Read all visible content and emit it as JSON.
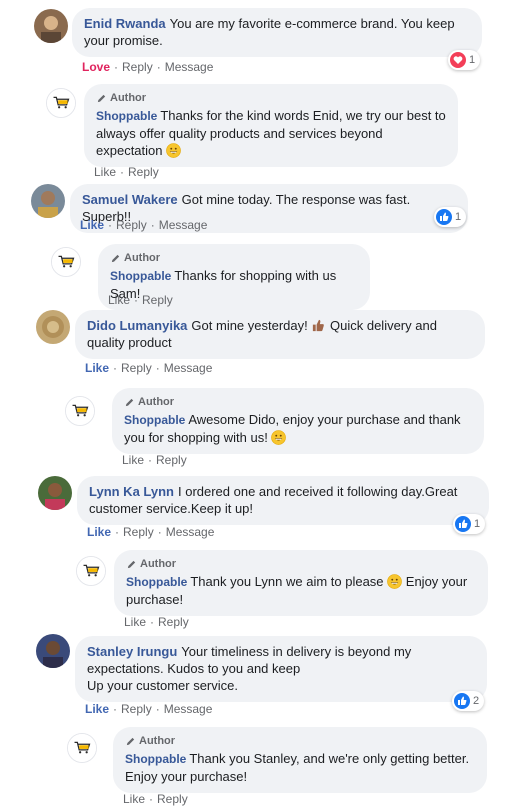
{
  "author_badge": "Author",
  "page_name": "Shoppable",
  "logo_text": "Shoppable",
  "actions": {
    "love": "Love",
    "like": "Like",
    "reply": "Reply",
    "message": "Message"
  },
  "comments": [
    {
      "name": "Enid Rwanda",
      "text": "You are my favorite e-commerce brand. You keep your promise.",
      "reaction_count": "1",
      "reaction_type": "love",
      "reply": "Thanks for the kind words Enid, we try our best to always offer quality products and services beyond expectation"
    },
    {
      "name": "Samuel Wakere",
      "text": "Got mine today. The response was fast. Superb!!",
      "reaction_count": "1",
      "reaction_type": "like",
      "reply": "Thanks for shopping with us Sam!"
    },
    {
      "name": "Dido Lumanyika",
      "text_a": "Got mine yesterday!",
      "text_b": "Quick delivery and quality product",
      "reply_a": "Awesome Dido, enjoy your purchase and thank you for shopping with us!"
    },
    {
      "name": "Lynn Ka Lynn",
      "text": "I ordered one and received it following day.Great customer service.Keep it up!",
      "reaction_count": "1",
      "reaction_type": "like",
      "reply_a": "Thank you Lynn we aim to please",
      "reply_b": "Enjoy your purchase!"
    },
    {
      "name": "Stanley Irungu",
      "line1": "Your timeliness in delivery is beyond my expectations. Kudos to you and keep",
      "line2": "Up your customer service.",
      "reaction_count": "2",
      "reaction_type": "like",
      "reply": "Thank you Stanley, and we're only getting better. Enjoy your purchase!"
    }
  ],
  "colors": {
    "name": "#385898",
    "like": "#4267b2",
    "love": "#e0245e",
    "bubble": "#f0f2f5",
    "muted": "#65676b"
  }
}
